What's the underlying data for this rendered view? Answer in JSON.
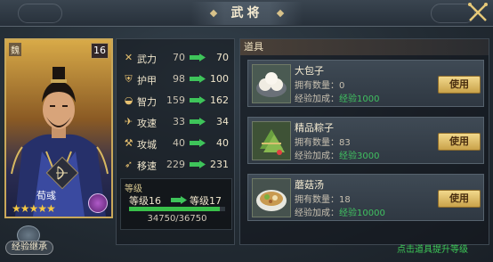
{
  "header": {
    "title": "武将"
  },
  "hero": {
    "faction": "魏",
    "level": "16",
    "name": "荀彧",
    "stars": "★★★★★"
  },
  "inherit_button": "经验继承",
  "stats": [
    {
      "name": "武力",
      "icon": "sword-icon",
      "from": "70",
      "to": "70"
    },
    {
      "name": "护甲",
      "icon": "shield-icon",
      "from": "98",
      "to": "100"
    },
    {
      "name": "智力",
      "icon": "fan-icon",
      "from": "159",
      "to": "162"
    },
    {
      "name": "攻速",
      "icon": "speed-icon",
      "from": "33",
      "to": "34"
    },
    {
      "name": "攻城",
      "icon": "siege-icon",
      "from": "40",
      "to": "40"
    },
    {
      "name": "移速",
      "icon": "boot-icon",
      "from": "229",
      "to": "231"
    }
  ],
  "level_section": {
    "tag": "等级",
    "from": "等级16",
    "to": "等级17",
    "exp_text": "34750/36750",
    "progress": 0.9456
  },
  "items_panel": {
    "header": "道具",
    "items": [
      {
        "name": "大包子",
        "own_label": "拥有数量：",
        "own": "0",
        "exp_label": "经验加成：",
        "exp": "经验1000",
        "button": "使用"
      },
      {
        "name": "精品粽子",
        "own_label": "拥有数量：",
        "own": "83",
        "exp_label": "经验加成：",
        "exp": "经验3000",
        "button": "使用"
      },
      {
        "name": "蘑菇汤",
        "own_label": "拥有数量：",
        "own": "18",
        "exp_label": "经验加成：",
        "exp": "经验10000",
        "button": "使用"
      }
    ]
  },
  "hint": "点击道具提升等级",
  "colors": {
    "accent_gold": "#c9a85a",
    "exp_green": "#40c060",
    "bar_green": "#39c04a"
  }
}
